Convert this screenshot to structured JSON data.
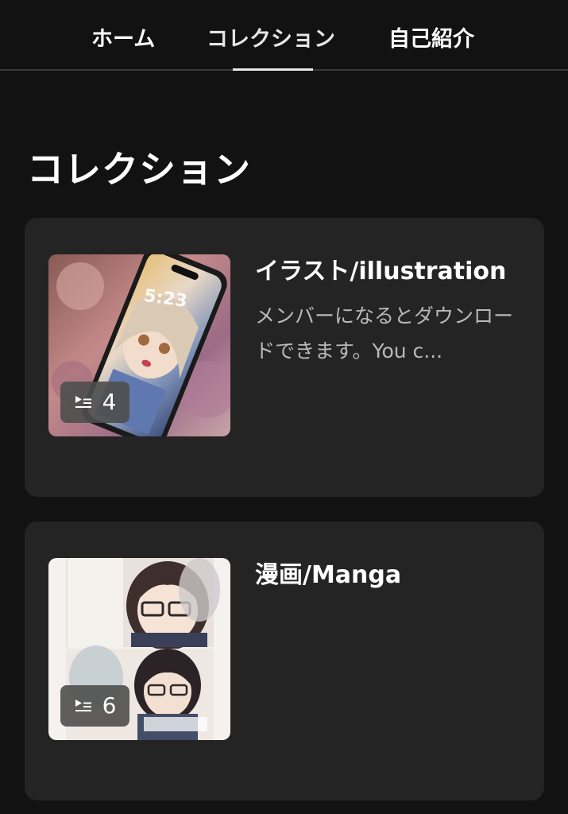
{
  "tabs": [
    {
      "label": "ホーム"
    },
    {
      "label": "コレクション",
      "active": true
    },
    {
      "label": "自己紹介"
    }
  ],
  "page": {
    "title": "コレクション"
  },
  "collections": [
    {
      "title": "イラスト/illustration",
      "description": "メンバーになるとダウンロードできます。You c...",
      "count": "4",
      "icon": "playlist-icon"
    },
    {
      "title": "漫画/Manga",
      "description": "",
      "count": "6",
      "icon": "playlist-icon"
    }
  ],
  "colors": {
    "background": "#121212",
    "card": "#242424",
    "text": "#ffffff",
    "muted_text": "#b9b9b9",
    "tab_indicator": "#e8e8e8"
  }
}
